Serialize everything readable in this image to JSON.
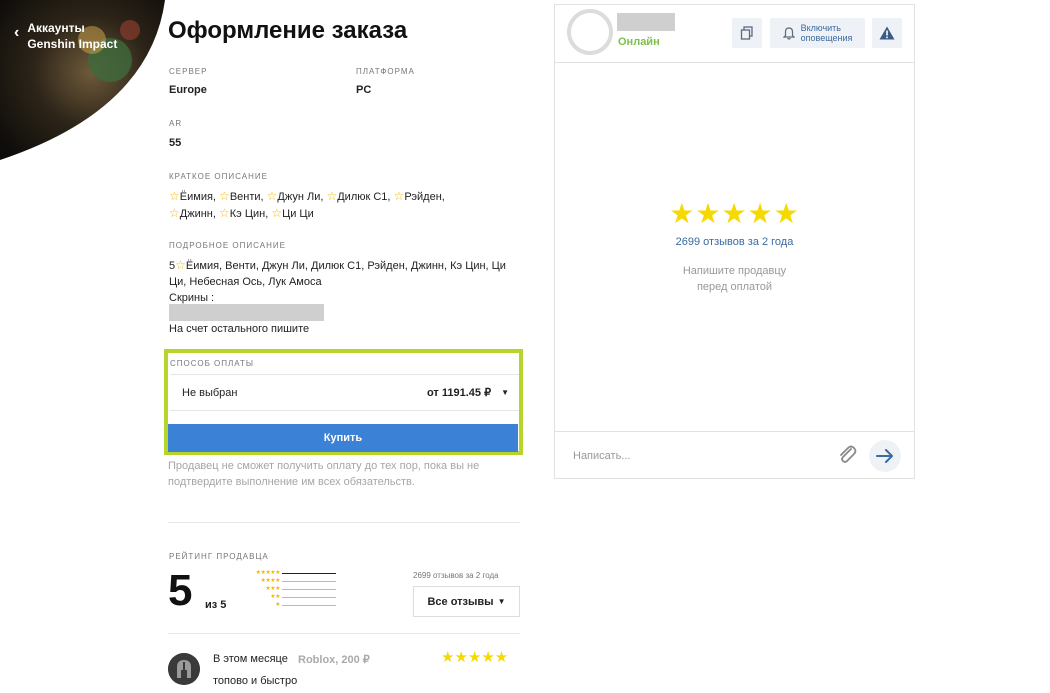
{
  "nav": {
    "back_label": "Аккаунты Genshin Impact"
  },
  "order": {
    "title": "Оформление заказа",
    "server": {
      "label": "СЕРВЕР",
      "value": "Europe"
    },
    "platform": {
      "label": "ПЛАТФОРМА",
      "value": "PC"
    },
    "ar": {
      "label": "AR",
      "value": "55"
    },
    "short_desc": {
      "label": "КРАТКОЕ ОПИСАНИЕ",
      "items": [
        "Ёимия,",
        "Венти,",
        "Джун Ли,",
        "Дилюк C1,",
        "Рэйден,",
        "Джинн,",
        "Кэ Цин,",
        "Ци Ци"
      ]
    },
    "detailed_desc": {
      "label": "ПОДРОБНОЕ ОПИСАНИЕ",
      "prefix": "5",
      "line1": "Ёимия, Венти, Джун Ли, Дилюк C1, Рэйден, Джинн, Кэ Цин, Ци",
      "line2": "Ци, Небесная Ось, Лук Амоса",
      "screens": "Скрины :",
      "rest": "На счет остального пишите"
    },
    "payment": {
      "label": "СПОСОБ ОПЛАТЫ",
      "selected": "Не выбран",
      "price": "от 1191.45 ₽",
      "buy_label": "Купить"
    },
    "note": "Продавец не сможет получить оплату до тех пор, пока вы не подтвердите выполнение им всех обязательств."
  },
  "seller_rating": {
    "label": "РЕЙТИНГ ПРОДАВЦА",
    "score": "5",
    "out_of": "из 5",
    "bars": [
      {
        "stars": "★★★★★",
        "fraction": 1
      },
      {
        "stars": "★★★★",
        "fraction": 0
      },
      {
        "stars": "★★★",
        "fraction": 0
      },
      {
        "stars": "★★",
        "fraction": 0
      },
      {
        "stars": "★",
        "fraction": 0
      }
    ],
    "reviews_count": "2699 отзывов за 2 года",
    "all_reviews_label": "Все отзывы",
    "review": {
      "when": "В этом месяце",
      "item": "Roblox, 200 ₽",
      "stars": "★★★★★",
      "text": "топово и быстро"
    }
  },
  "chat": {
    "status": "Онлайн",
    "notify_label_1": "Включить",
    "notify_label_2": "оповещения",
    "stars": "★★★★★",
    "reviews": "2699 отзывов за 2 года",
    "hint_1": "Напишите продавцу",
    "hint_2": "перед оплатой",
    "input_placeholder": "Написать..."
  },
  "colors": {
    "accent": "#3b82d6",
    "highlight": "#b5d52a",
    "online": "#7cc147",
    "star": "#f5d900"
  },
  "icons": [
    "chevron-left-icon",
    "copy-icon",
    "bell-icon",
    "warning-icon",
    "paperclip-icon",
    "arrow-right-icon",
    "star-icon",
    "caret-down-icon"
  ]
}
